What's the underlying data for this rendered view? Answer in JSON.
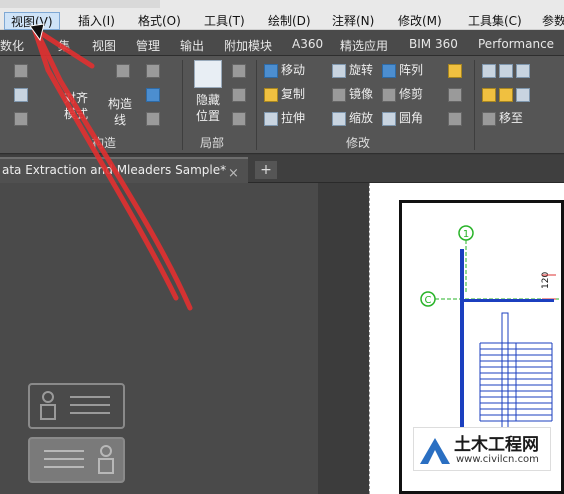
{
  "menubar": {
    "items": [
      "视图(V)",
      "插入(I)",
      "格式(O)",
      "工具(T)",
      "绘制(D)",
      "注释(N)",
      "修改(M)",
      "工具集(C)",
      "参数"
    ],
    "active_index": 0
  },
  "ribbon_tabs": [
    "数化",
    "集",
    "视图",
    "管理",
    "输出",
    "附加模块",
    "A360",
    "精选应用",
    "BIM 360",
    "Performance"
  ],
  "ribbon": {
    "left_labels": {
      "match_text": "对齐",
      "match_text2": "模式",
      "construct": "构造",
      "construct2": "线"
    },
    "group_construct": "构造",
    "section_hide": {
      "line1": "隐藏",
      "line2": "位置",
      "footer": "局部"
    },
    "modify_tools": [
      "移动",
      "旋转",
      "阵列",
      "复制",
      "镜像",
      "修剪",
      "拉伸",
      "缩放",
      "圆角"
    ],
    "group_modify": "修改",
    "right_tool": "移至"
  },
  "doc_tab": {
    "title": "ata Extraction and Mleaders Sample*",
    "close": "×",
    "add": "+"
  },
  "drawing": {
    "grid_labels": [
      "1",
      "C"
    ],
    "dimension": "120"
  },
  "watermark": {
    "title": "土木工程网",
    "url": "www.civilcn.com"
  }
}
